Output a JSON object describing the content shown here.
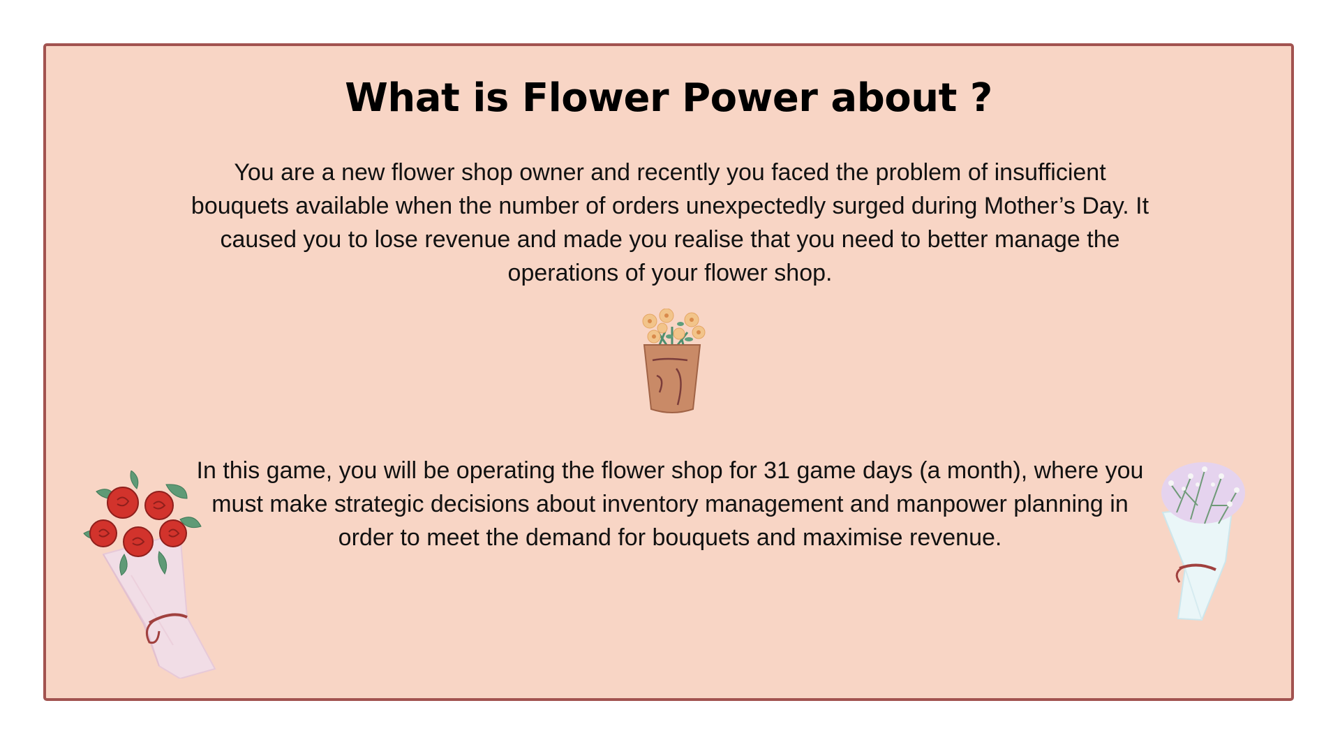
{
  "slide": {
    "title": "What is Flower Power about ?",
    "paragraph_1": "You are a new flower shop owner and recently you faced the problem of insufficient bouquets available when the number of orders unexpectedly surged during Mother’s Day. It caused you to lose revenue and made you realise that you need to better manage the operations of your flower shop.",
    "paragraph_2": "In this game, you will be operating the flower shop for 31 game days (a month), where you must make strategic decisions about inventory management and manpower planning in order to meet the demand for bouquets and maximise revenue."
  },
  "illustrations": {
    "center": "peach-flowers-in-paper-cup-icon",
    "left": "red-rose-bouquet-icon",
    "right": "babys-breath-bouquet-icon"
  },
  "colors": {
    "background": "#f8d5c5",
    "border": "#a25350",
    "text": "#111111"
  }
}
